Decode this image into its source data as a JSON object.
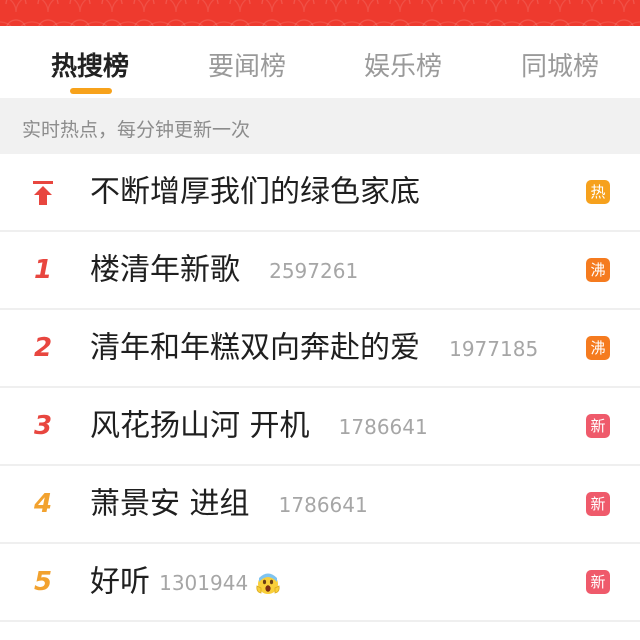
{
  "tabs": [
    {
      "label": "热搜榜",
      "active": true
    },
    {
      "label": "要闻榜",
      "active": false
    },
    {
      "label": "娱乐榜",
      "active": false
    },
    {
      "label": "同城榜",
      "active": false
    }
  ],
  "subheader": "实时热点，每分钟更新一次",
  "colors": {
    "banner": "#ee3a2e",
    "indicator": "#f7a21b",
    "rank_top": "#e8463f",
    "rank_low": "#f2a22f",
    "badge_hot": "#f6a11d",
    "badge_boil": "#f57b1f",
    "badge_new": "#ef5a6b"
  },
  "items": [
    {
      "rank": "",
      "icon": "pin-top-icon",
      "title": "不断增厚我们的绿色家底",
      "heat": "",
      "badge": "热"
    },
    {
      "rank": "1",
      "title": "楼清年新歌",
      "heat": "2597261",
      "badge": "沸"
    },
    {
      "rank": "2",
      "title": "清年和年糕双向奔赴的爱",
      "heat": "1977185",
      "badge": "沸"
    },
    {
      "rank": "3",
      "title": "风花扬山河 开机",
      "heat": "1786641",
      "badge": "新"
    },
    {
      "rank": "4",
      "title": "萧景安 进组",
      "heat": "1786641",
      "badge": "新"
    },
    {
      "rank": "5",
      "title": "好听",
      "heat": "1301944",
      "emoji": "screaming-face-icon",
      "badge": "新"
    }
  ]
}
